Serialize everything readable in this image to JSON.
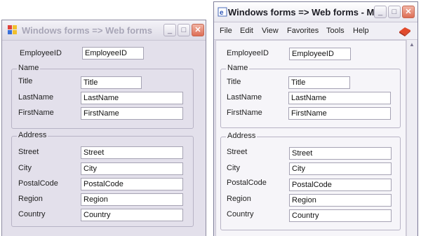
{
  "left_window": {
    "title": "Windows forms => Web forms",
    "employee_id": {
      "label": "EmployeeID",
      "value": "EmployeeID"
    },
    "name_group": {
      "title": "Name",
      "fields": [
        {
          "label": "Title",
          "value": "Title"
        },
        {
          "label": "LastName",
          "value": "LastName"
        },
        {
          "label": "FirstName",
          "value": "FirstName"
        }
      ]
    },
    "address_group": {
      "title": "Address",
      "fields": [
        {
          "label": "Street",
          "value": "Street"
        },
        {
          "label": "City",
          "value": "City"
        },
        {
          "label": "PostalCode",
          "value": "PostalCode"
        },
        {
          "label": "Region",
          "value": "Region"
        },
        {
          "label": "Country",
          "value": "Country"
        }
      ]
    }
  },
  "right_window": {
    "title": "Windows forms => Web forms - M...",
    "menu": [
      "File",
      "Edit",
      "View",
      "Favorites",
      "Tools",
      "Help"
    ],
    "employee_id": {
      "label": "EmployeeID",
      "value": "EmployeeID"
    },
    "name_group": {
      "title": "Name",
      "fields": [
        {
          "label": "Title",
          "value": "Title"
        },
        {
          "label": "LastName",
          "value": "LastName"
        },
        {
          "label": "FirstName",
          "value": "FirstName"
        }
      ]
    },
    "address_group": {
      "title": "Address",
      "fields": [
        {
          "label": "Street",
          "value": "Street"
        },
        {
          "label": "City",
          "value": "City"
        },
        {
          "label": "PostalCode",
          "value": "PostalCode"
        },
        {
          "label": "Region",
          "value": "Region"
        },
        {
          "label": "Country",
          "value": "Country"
        }
      ]
    }
  },
  "colors": {
    "close_button": "#dd6e55",
    "title_inactive": "#a8a6b7"
  }
}
